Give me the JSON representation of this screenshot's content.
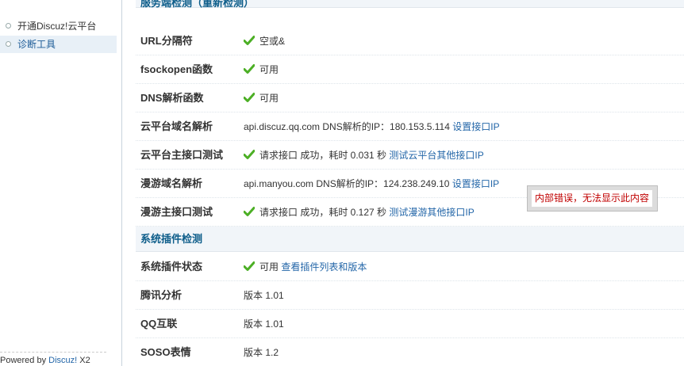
{
  "sidebar": {
    "items": [
      {
        "label": "开通Discuz!云平台"
      },
      {
        "label": "诊断工具"
      }
    ],
    "powered_prefix": "Powered by ",
    "powered_link": "Discuz!",
    "powered_suffix": " X2"
  },
  "main": {
    "section1_title": "服务端检测（重新检测）",
    "rows1": [
      {
        "label": "URL分隔符",
        "value": "空或&"
      },
      {
        "label": "fsockopen函数",
        "value": "可用"
      },
      {
        "label": "DNS解析函数",
        "value": "可用"
      },
      {
        "label": "云平台域名解析",
        "value": "api.discuz.qq.com DNS解析的IP：180.153.5.114",
        "link": "设置接口IP"
      },
      {
        "label": "云平台主接口测试",
        "value": "请求接口 成功，耗时 0.031 秒",
        "link": "测试云平台其他接口IP"
      },
      {
        "label": "漫游域名解析",
        "value": "api.manyou.com DNS解析的IP：124.238.249.10",
        "link": "设置接口IP"
      },
      {
        "label": "漫游主接口测试",
        "value": "请求接口 成功，耗时 0.127 秒",
        "link": "测试漫游其他接口IP"
      }
    ],
    "section2_title": "系统插件检测",
    "rows2": [
      {
        "label": "系统插件状态",
        "value": "可用",
        "link": "查看插件列表和版本"
      },
      {
        "label": "腾讯分析",
        "value": "版本 1.01"
      },
      {
        "label": "QQ互联",
        "value": "版本 1.01"
      },
      {
        "label": "SOSO表情",
        "value": "版本 1.2"
      }
    ]
  },
  "tooltip": {
    "text": "内部错误，无法显示此内容"
  },
  "icons": {
    "check": "check-icon"
  },
  "colors": {
    "accent": "#0d5d8a",
    "link": "#2366a8",
    "check": "#4caf25",
    "error": "#c00000"
  }
}
